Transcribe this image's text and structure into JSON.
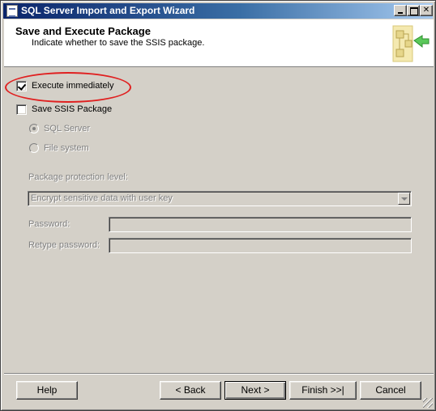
{
  "window": {
    "title": "SQL Server Import and Export Wizard"
  },
  "header": {
    "title": "Save and Execute Package",
    "subtitle": "Indicate whether to save the SSIS package.",
    "logo_icon": "wizard-logo-icon"
  },
  "options": {
    "execute_immediately": {
      "label": "Execute immediately",
      "checked": true
    },
    "save_ssis_package": {
      "label": "Save SSIS Package",
      "checked": false
    },
    "sql_server": {
      "label": "SQL Server",
      "selected": true,
      "enabled": false
    },
    "file_system": {
      "label": "File system",
      "selected": false,
      "enabled": false
    }
  },
  "protection": {
    "label": "Package protection level:",
    "value": "Encrypt sensitive data with user key"
  },
  "password": {
    "label": "Password:",
    "value": ""
  },
  "retype_password": {
    "label": "Retype password:",
    "value": ""
  },
  "buttons": {
    "help": "Help",
    "back": "< Back",
    "next": "Next >",
    "finish": "Finish >>|",
    "cancel": "Cancel"
  },
  "colors": {
    "highlight_oval": "#e02020",
    "titlebar_start": "#0a246a",
    "titlebar_end": "#a6caf0"
  }
}
